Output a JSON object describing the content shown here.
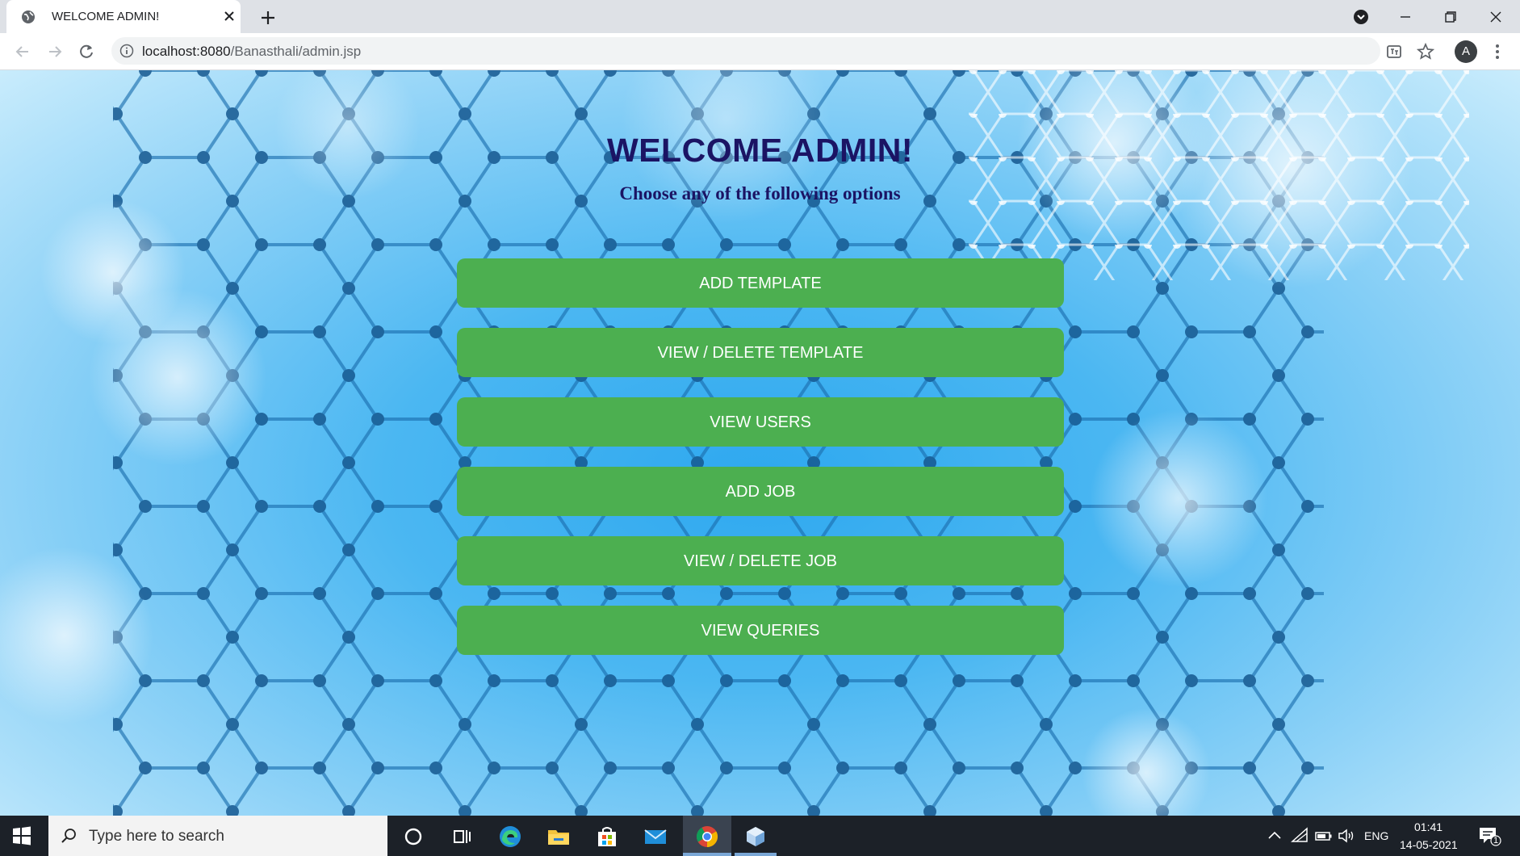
{
  "browser": {
    "tab": {
      "title": "WELCOME ADMIN!",
      "favicon": "globe-icon"
    },
    "address_bar": {
      "host": "localhost:8080",
      "path": "/Banasthali/admin.jsp"
    },
    "profile_initial": "A"
  },
  "page": {
    "heading": "WELCOME ADMIN!",
    "subheading": "Choose any of the following options",
    "options": [
      {
        "label": "ADD TEMPLATE"
      },
      {
        "label": "VIEW / DELETE TEMPLATE"
      },
      {
        "label": "VIEW USERS"
      },
      {
        "label": "ADD JOB"
      },
      {
        "label": "VIEW / DELETE JOB"
      },
      {
        "label": "VIEW QUERIES"
      }
    ],
    "button_color": "#4caf50",
    "heading_color": "#1b1464"
  },
  "taskbar": {
    "search_placeholder": "Type here to search",
    "apps": [
      "cortana-icon",
      "task-view-icon",
      "edge-icon",
      "file-explorer-icon",
      "store-icon",
      "mail-icon",
      "chrome-icon",
      "app-cube-icon"
    ],
    "language": "ENG",
    "time": "01:41",
    "date": "14-05-2021",
    "notification_count": "1"
  }
}
